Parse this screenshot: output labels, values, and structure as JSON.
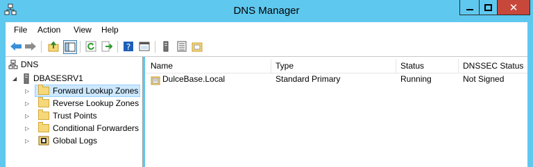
{
  "window": {
    "title": "DNS Manager",
    "close_glyph": "✕"
  },
  "menu": [
    "File",
    "Action",
    "View",
    "Help"
  ],
  "toolbar": {
    "icons": [
      "back-arrow-icon",
      "forward-arrow-icon",
      "up-folder-icon",
      "show-hide-console-tree-icon",
      "refresh-icon",
      "export-list-icon",
      "help-icon",
      "properties-icon",
      "server-icon",
      "list-view-icon",
      "new-zone-icon"
    ]
  },
  "tree": {
    "root": "DNS",
    "server": "DBASESRV1",
    "items": [
      "Forward Lookup Zones",
      "Reverse Lookup Zones",
      "Trust Points",
      "Conditional Forwarders",
      "Global Logs"
    ]
  },
  "list": {
    "columns": [
      "Name",
      "Type",
      "Status",
      "DNSSEC Status"
    ],
    "rows": [
      {
        "name": "DulceBase.Local",
        "type": "Standard Primary",
        "status": "Running",
        "dnssec": "Not Signed"
      }
    ]
  },
  "colors": {
    "titlebar": "#5fc8ef",
    "close": "#c7483b",
    "selection": "#cce8ff"
  }
}
